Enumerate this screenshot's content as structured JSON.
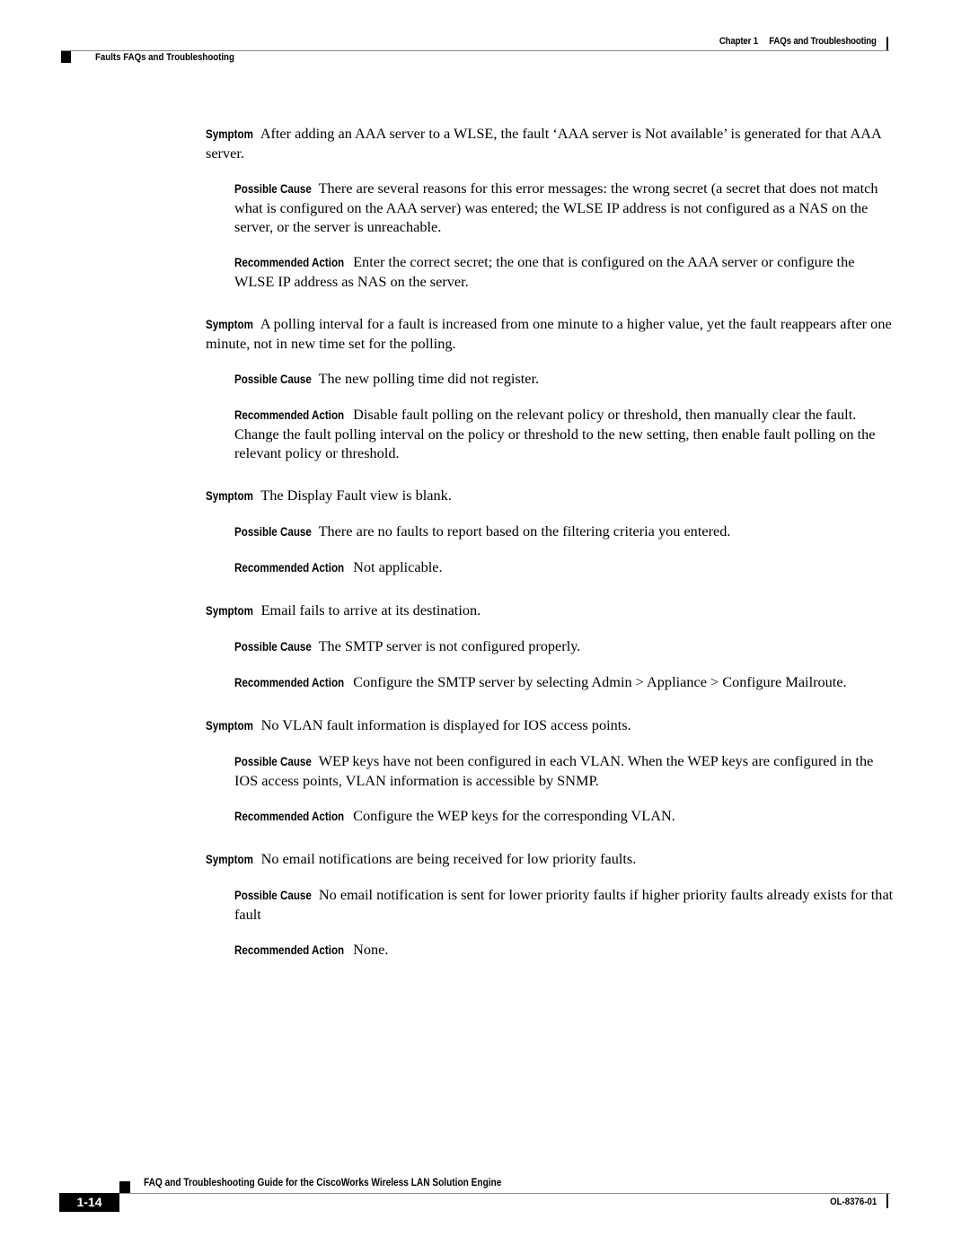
{
  "header": {
    "chapter_label": "Chapter 1",
    "chapter_title": "FAQs and Troubleshooting",
    "section_title": "Faults FAQs and Troubleshooting"
  },
  "labels": {
    "symptom": "Symptom",
    "possible_cause": "Possible Cause",
    "recommended_action": "Recommended Action"
  },
  "entries": [
    {
      "symptom": "After adding an AAA server to a WLSE, the fault ‘AAA server is Not available’ is generated for that AAA server.",
      "cause": "There are several reasons for this error messages: the wrong secret (a secret that does not match what is configured on the AAA server) was entered; the WLSE IP address is not configured as a NAS on the server, or the server is unreachable.",
      "action": "Enter the correct secret; the one that is configured on the AAA server or configure the WLSE IP address as NAS on the server."
    },
    {
      "symptom": "A polling interval for a fault is increased from one minute to a higher value, yet the fault reappears after one minute, not in new time set for the polling.",
      "cause": "The new polling time did not register.",
      "action": "Disable fault polling on the relevant policy or threshold, then manually clear the fault. Change the fault polling interval on the policy or threshold to the new setting, then enable fault polling on the relevant policy or threshold."
    },
    {
      "symptom": "The Display Fault view is blank.",
      "cause": "There are no faults to report based on the filtering criteria you entered.",
      "action": "Not applicable."
    },
    {
      "symptom": "Email fails to arrive at its destination.",
      "cause": "The SMTP server is not configured properly.",
      "action": "Configure the SMTP server by selecting Admin > Appliance > Configure Mailroute."
    },
    {
      "symptom": "No VLAN fault information is displayed for IOS access points.",
      "cause": "WEP keys have not been configured in each VLAN. When the WEP keys are configured in the IOS access points, VLAN information is accessible by SNMP.",
      "action": "Configure the WEP keys for the corresponding VLAN."
    },
    {
      "symptom": "No email notifications are being received for low priority faults.",
      "cause": "No email notification is sent for lower priority faults if higher priority faults already exists for that fault",
      "action": "None."
    }
  ],
  "footer": {
    "guide_title": "FAQ and Troubleshooting Guide for the CiscoWorks Wireless LAN Solution Engine",
    "page_number": "1-14",
    "doc_number": "OL-8376-01"
  }
}
